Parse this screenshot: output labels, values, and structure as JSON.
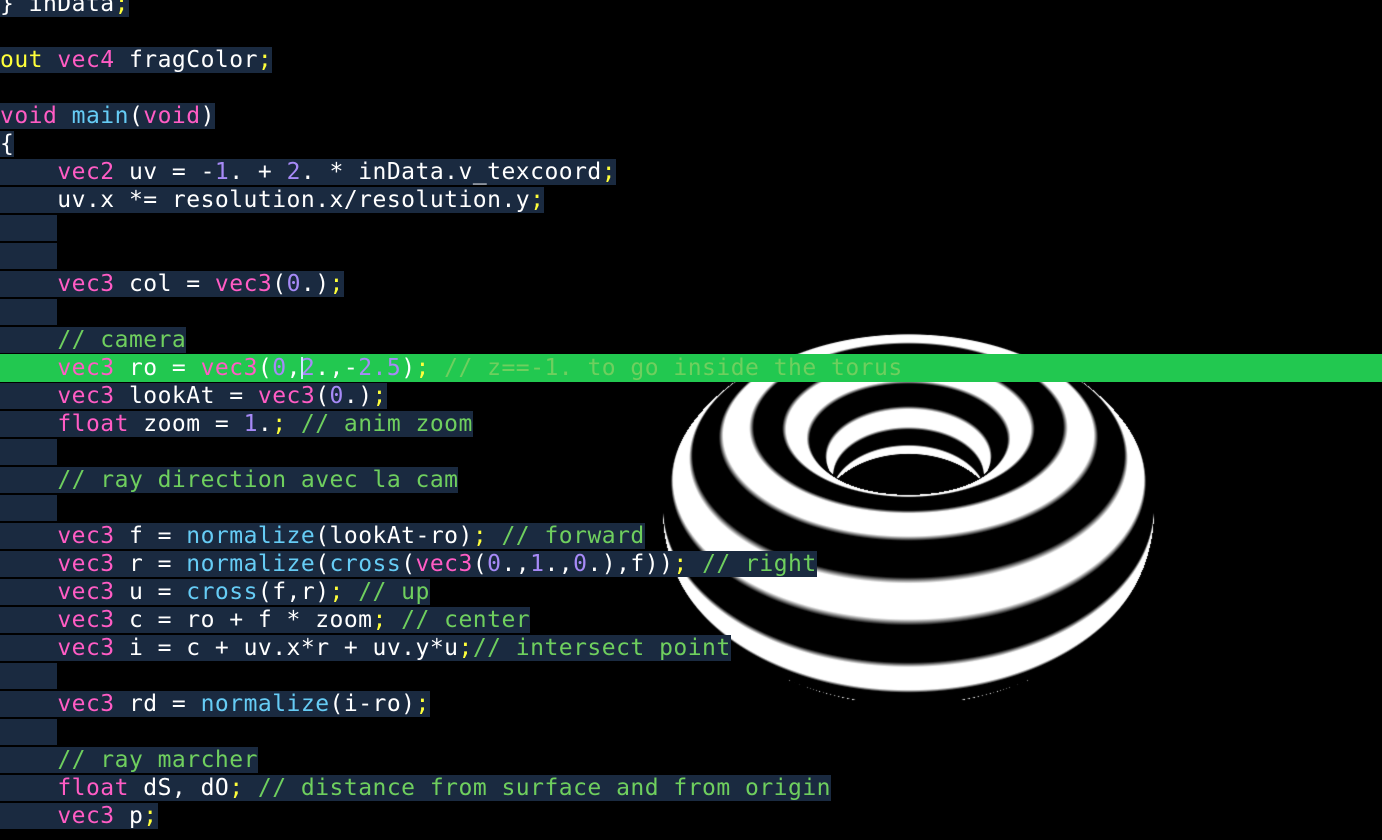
{
  "editor": {
    "active_line": 13,
    "caret_line": 13,
    "caret_col": 21,
    "lines": [
      [
        [
          "}",
          "w"
        ],
        [
          " inData",
          "w"
        ],
        [
          ";",
          "y"
        ]
      ],
      [],
      [
        [
          "out",
          "y"
        ],
        [
          " ",
          "w"
        ],
        [
          "vec4",
          "p"
        ],
        [
          " fragColor",
          "w"
        ],
        [
          ";",
          "y"
        ]
      ],
      [],
      [
        [
          "void",
          "p"
        ],
        [
          " ",
          "w"
        ],
        [
          "main",
          "c"
        ],
        [
          "(",
          "w"
        ],
        [
          "void",
          "p"
        ],
        [
          ")",
          "w"
        ]
      ],
      [
        [
          "{",
          "w"
        ]
      ],
      [
        [
          "    ",
          "w"
        ],
        [
          "vec2",
          "p"
        ],
        [
          " uv = -",
          "w"
        ],
        [
          "1",
          "n"
        ],
        [
          ". + ",
          "w"
        ],
        [
          "2",
          "n"
        ],
        [
          ". * inData.v_texcoord",
          "w"
        ],
        [
          ";",
          "y"
        ]
      ],
      [
        [
          "    uv.x *= resolution.x/resolution.y",
          "w"
        ],
        [
          ";",
          "y"
        ]
      ],
      [
        [
          "    ",
          "w"
        ]
      ],
      [
        [
          "    ",
          "w"
        ]
      ],
      [
        [
          "    ",
          "w"
        ],
        [
          "vec3",
          "p"
        ],
        [
          " col = ",
          "w"
        ],
        [
          "vec3",
          "p"
        ],
        [
          "(",
          "w"
        ],
        [
          "0",
          "n"
        ],
        [
          ".)",
          "w"
        ],
        [
          ";",
          "y"
        ]
      ],
      [
        [
          "    ",
          "w"
        ]
      ],
      [
        [
          "    ",
          "w"
        ],
        [
          "// camera",
          "g"
        ]
      ],
      [
        [
          "    ",
          "w"
        ],
        [
          "vec3",
          "p"
        ],
        [
          " ro = ",
          "w"
        ],
        [
          "vec3",
          "p"
        ],
        [
          "(",
          "w"
        ],
        [
          "0",
          "n"
        ],
        [
          ",",
          "w"
        ],
        [
          "2",
          "n"
        ],
        [
          ".,-",
          "w"
        ],
        [
          "2.5",
          "n"
        ],
        [
          ")",
          "w"
        ],
        [
          ";",
          "y"
        ],
        [
          " ",
          "w"
        ],
        [
          "// z==-1. to go inside the torus",
          "g"
        ]
      ],
      [
        [
          "    ",
          "w"
        ],
        [
          "vec3",
          "p"
        ],
        [
          " lookAt = ",
          "w"
        ],
        [
          "vec3",
          "p"
        ],
        [
          "(",
          "w"
        ],
        [
          "0",
          "n"
        ],
        [
          ".)",
          "w"
        ],
        [
          ";",
          "y"
        ]
      ],
      [
        [
          "    ",
          "w"
        ],
        [
          "float",
          "p"
        ],
        [
          " zoom = ",
          "w"
        ],
        [
          "1",
          "n"
        ],
        [
          ".",
          "w"
        ],
        [
          ";",
          "y"
        ],
        [
          " ",
          "w"
        ],
        [
          "// anim zoom",
          "g"
        ]
      ],
      [
        [
          "    ",
          "w"
        ]
      ],
      [
        [
          "    ",
          "w"
        ],
        [
          "// ray direction avec la cam",
          "g"
        ]
      ],
      [
        [
          "    ",
          "w"
        ]
      ],
      [
        [
          "    ",
          "w"
        ],
        [
          "vec3",
          "p"
        ],
        [
          " f = ",
          "w"
        ],
        [
          "normalize",
          "c"
        ],
        [
          "(lookAt-ro)",
          "w"
        ],
        [
          ";",
          "y"
        ],
        [
          " ",
          "w"
        ],
        [
          "// forward",
          "g"
        ]
      ],
      [
        [
          "    ",
          "w"
        ],
        [
          "vec3",
          "p"
        ],
        [
          " r = ",
          "w"
        ],
        [
          "normalize",
          "c"
        ],
        [
          "(",
          "w"
        ],
        [
          "cross",
          "c"
        ],
        [
          "(",
          "w"
        ],
        [
          "vec3",
          "p"
        ],
        [
          "(",
          "w"
        ],
        [
          "0",
          "n"
        ],
        [
          ".,",
          "w"
        ],
        [
          "1",
          "n"
        ],
        [
          ".,",
          "w"
        ],
        [
          "0",
          "n"
        ],
        [
          ".),f))",
          "w"
        ],
        [
          ";",
          "y"
        ],
        [
          " ",
          "w"
        ],
        [
          "// right",
          "g"
        ]
      ],
      [
        [
          "    ",
          "w"
        ],
        [
          "vec3",
          "p"
        ],
        [
          " u = ",
          "w"
        ],
        [
          "cross",
          "c"
        ],
        [
          "(f,r)",
          "w"
        ],
        [
          ";",
          "y"
        ],
        [
          " ",
          "w"
        ],
        [
          "// up",
          "g"
        ]
      ],
      [
        [
          "    ",
          "w"
        ],
        [
          "vec3",
          "p"
        ],
        [
          " c = ro + f * zoom",
          "w"
        ],
        [
          ";",
          "y"
        ],
        [
          " ",
          "w"
        ],
        [
          "// center",
          "g"
        ]
      ],
      [
        [
          "    ",
          "w"
        ],
        [
          "vec3",
          "p"
        ],
        [
          " i = c + uv.x*r + uv.y*u",
          "w"
        ],
        [
          ";",
          "y"
        ],
        [
          "// intersect point",
          "g"
        ]
      ],
      [
        [
          "    ",
          "w"
        ]
      ],
      [
        [
          "    ",
          "w"
        ],
        [
          "vec3",
          "p"
        ],
        [
          " rd = ",
          "w"
        ],
        [
          "normalize",
          "c"
        ],
        [
          "(i-ro)",
          "w"
        ],
        [
          ";",
          "y"
        ]
      ],
      [
        [
          "    ",
          "w"
        ]
      ],
      [
        [
          "    ",
          "w"
        ],
        [
          "// ray marcher",
          "g"
        ]
      ],
      [
        [
          "    ",
          "w"
        ],
        [
          "float",
          "p"
        ],
        [
          " dS, dO",
          "w"
        ],
        [
          ";",
          "y"
        ],
        [
          " ",
          "w"
        ],
        [
          "// distance from surface and from origin",
          "g"
        ]
      ],
      [
        [
          "    ",
          "w"
        ],
        [
          "vec3",
          "p"
        ],
        [
          " p",
          "w"
        ],
        [
          ";",
          "y"
        ]
      ]
    ]
  },
  "syntax_colors": {
    "w": "#ffffff",
    "y": "#ffff3a",
    "p": "#ff5cc4",
    "c": "#66ccf5",
    "n": "#a78af7",
    "g": "#6fcf5e"
  },
  "render": {
    "object": "torus",
    "background": "#000000",
    "stripe_color": "#ffffff"
  }
}
